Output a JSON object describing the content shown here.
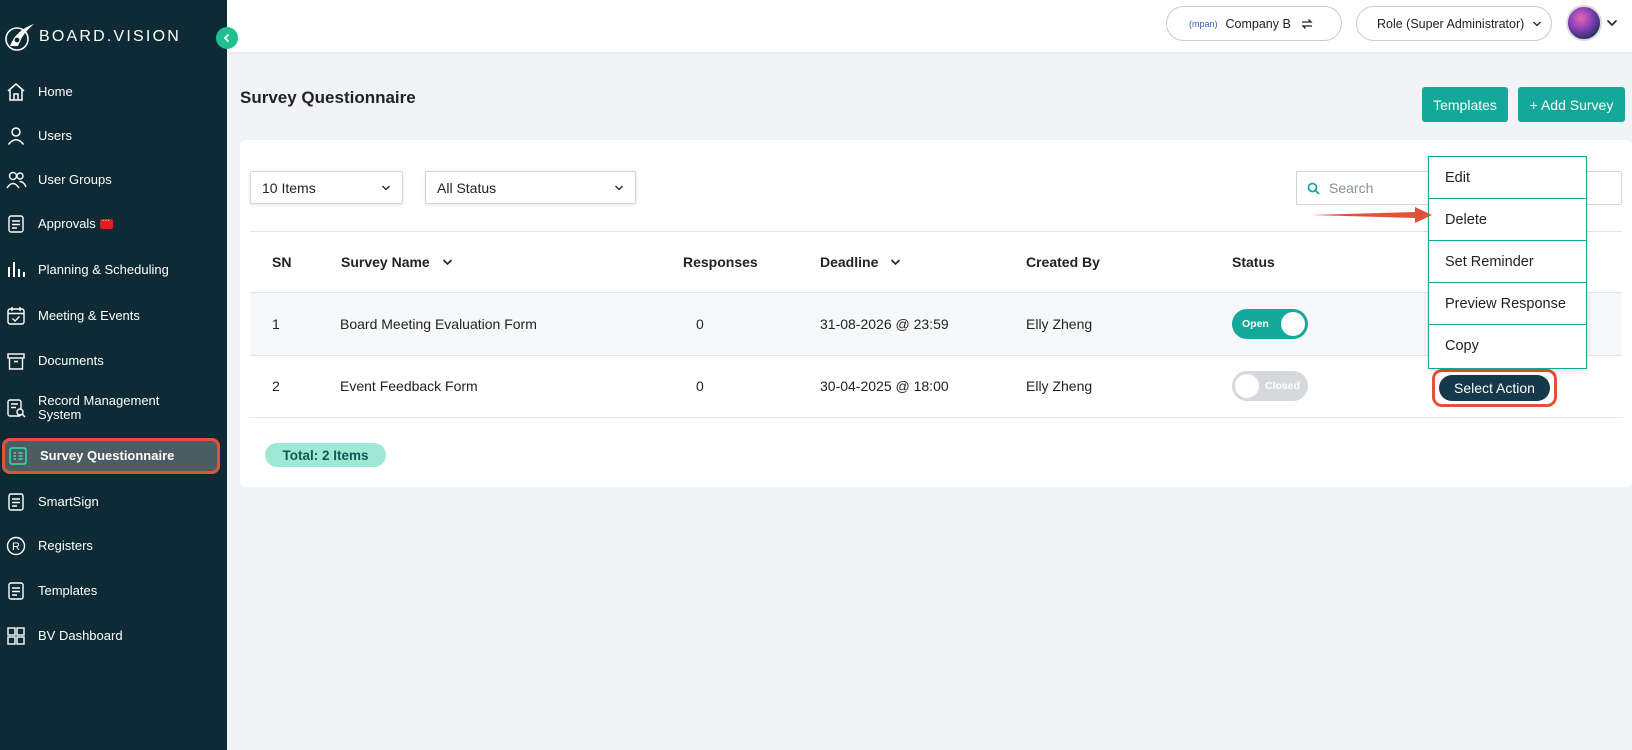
{
  "brand": {
    "name": "BOARD.VISION"
  },
  "sidebar": {
    "items": [
      {
        "label": "Home",
        "icon": "home-icon"
      },
      {
        "label": "Users",
        "icon": "user-icon"
      },
      {
        "label": "User Groups",
        "icon": "users-icon"
      },
      {
        "label": "Approvals",
        "icon": "approvals-icon"
      },
      {
        "label": "Planning & Scheduling",
        "icon": "bar-chart-icon"
      },
      {
        "label": "Meeting & Events",
        "icon": "calendar-icon"
      },
      {
        "label": "Documents",
        "icon": "archive-icon"
      },
      {
        "label": "Record Management",
        "label2": "System",
        "icon": "record-search-icon"
      },
      {
        "label": "Survey Questionnaire",
        "icon": "survey-icon",
        "active": true
      },
      {
        "label": "SmartSign",
        "icon": "document-icon"
      },
      {
        "label": "Registers",
        "icon": "registered-icon"
      },
      {
        "label": "Templates",
        "icon": "template-icon"
      },
      {
        "label": "BV Dashboard",
        "icon": "grid-icon"
      }
    ]
  },
  "topbar": {
    "company_label": "Company B",
    "company_logo_text": "(mpan)",
    "role_label": "Role (Super Administrator)"
  },
  "page": {
    "title": "Survey Questionnaire",
    "templates_button": "Templates",
    "add_button": "+ Add Survey"
  },
  "filters": {
    "items_per_page": "10 Items",
    "status": "All Status",
    "search_placeholder": "Search"
  },
  "table": {
    "headers": {
      "sn": "SN",
      "name": "Survey Name",
      "responses": "Responses",
      "deadline": "Deadline",
      "created_by": "Created By",
      "status": "Status"
    },
    "rows": [
      {
        "sn": "1",
        "name": "Board Meeting Evaluation Form",
        "responses": "0",
        "deadline": "31-08-2026 @ 23:59",
        "created_by": "Elly Zheng",
        "status": "Open"
      },
      {
        "sn": "2",
        "name": "Event Feedback Form",
        "responses": "0",
        "deadline": "30-04-2025 @ 18:00",
        "created_by": "Elly Zheng",
        "status": "Closed",
        "action": "Select Action"
      }
    ],
    "total": "Total: 2 Items"
  },
  "action_menu": {
    "items": [
      "Edit",
      "Delete",
      "Set Reminder",
      "Preview Response",
      "Copy"
    ]
  },
  "colors": {
    "sidebar_bg": "#0d2a35",
    "accent": "#13a89a",
    "highlight": "#e0533a",
    "action_button": "#15384a"
  }
}
